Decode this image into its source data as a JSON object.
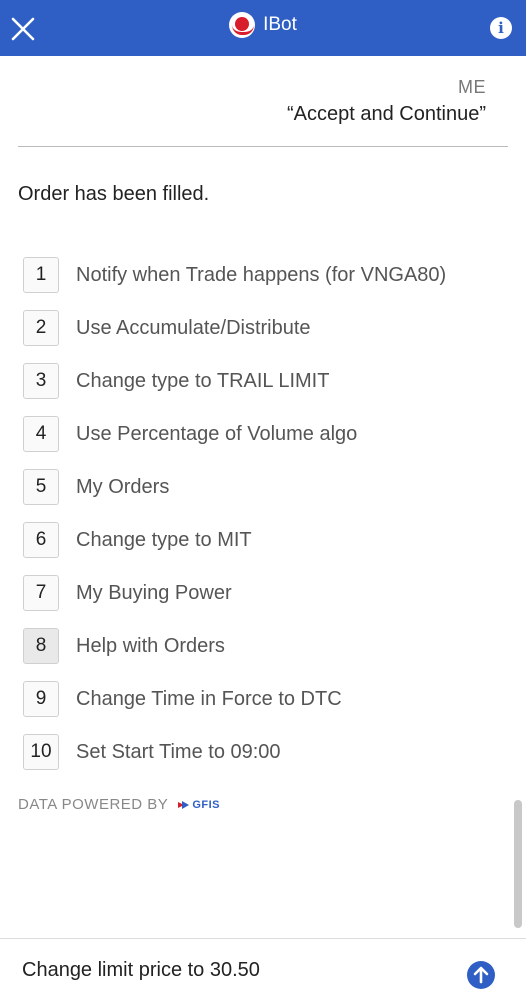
{
  "header": {
    "title": "IBot",
    "info_label": "i"
  },
  "user_message": {
    "sender": "ME",
    "text": "“Accept and Continue”"
  },
  "bot_message": {
    "text": "Order has been filled."
  },
  "suggestions": [
    {
      "num": "1",
      "label": "Notify when Trade happens (for VNGA80)"
    },
    {
      "num": "2",
      "label": "Use Accumulate/Distribute"
    },
    {
      "num": "3",
      "label": "Change type to TRAIL LIMIT"
    },
    {
      "num": "4",
      "label": "Use Percentage of Volume algo"
    },
    {
      "num": "5",
      "label": "My Orders"
    },
    {
      "num": "6",
      "label": "Change type to MIT"
    },
    {
      "num": "7",
      "label": "My Buying Power"
    },
    {
      "num": "8",
      "label": "Help with Orders"
    },
    {
      "num": "9",
      "label": "Change Time in Force to DTC"
    },
    {
      "num": "10",
      "label": "Set Start Time to 09:00"
    }
  ],
  "footer": {
    "powered_by": "DATA POWERED BY",
    "provider": "GFIS"
  },
  "input": {
    "value": "Change limit price to 30.50"
  },
  "colors": {
    "header_bg": "#2f5fc4",
    "logo_red": "#d81e2c"
  }
}
